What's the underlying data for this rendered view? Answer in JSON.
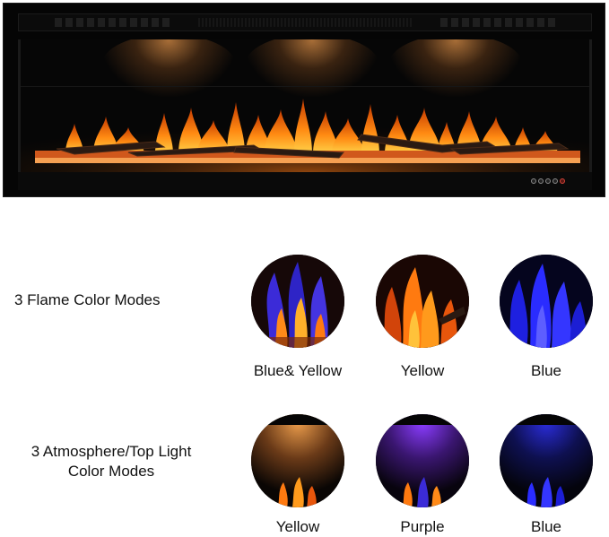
{
  "flame_modes": {
    "heading": "3 Flame Color Modes",
    "items": [
      {
        "label": "Blue& Yellow",
        "icon": "blue-yellow-flame-swatch"
      },
      {
        "label": "Yellow",
        "icon": "yellow-flame-swatch"
      },
      {
        "label": "Blue",
        "icon": "blue-flame-swatch"
      }
    ]
  },
  "light_modes": {
    "heading_line1": "3 Atmosphere/Top Light",
    "heading_line2": "Color Modes",
    "items": [
      {
        "label": "Yellow",
        "icon": "yellow-top-light-swatch"
      },
      {
        "label": "Purple",
        "icon": "purple-top-light-swatch"
      },
      {
        "label": "Blue",
        "icon": "blue-top-light-swatch"
      }
    ]
  },
  "colors": {
    "flame_orange": "#ff7a10",
    "flame_yellow": "#ffc23a",
    "flame_blue": "#2a2cff",
    "light_purple": "#8a3cff",
    "background": "#ffffff",
    "frame": "#050505"
  }
}
